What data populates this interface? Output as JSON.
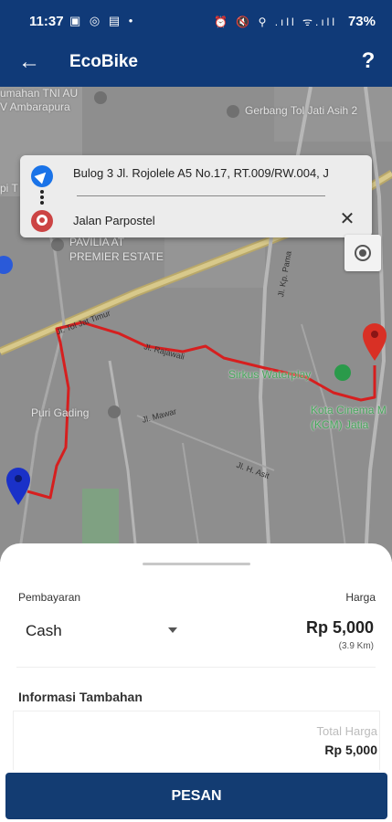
{
  "status_bar": {
    "time": "11:37",
    "left_icons": "▣ ◎ ▤ •",
    "right_icons": "⏰ 🔇 ⚲ .ıll ᯤ.ıll",
    "battery": "73%"
  },
  "app_bar": {
    "title": "EcoBike",
    "back_icon": "←",
    "help_icon": "?"
  },
  "map": {
    "labels": [
      "umahan TNI AU",
      "V Ambarapura",
      "Gerbang Tol Jati Asih 2",
      "PAVILIA AT",
      "PREMIER ESTATE",
      "Sirkus Waterplay",
      "Puri Gading",
      "Kota Cinema M",
      "(KCM) Jatia",
      "pi T",
      "Jl. Mawar",
      "Jl. H. Asit",
      "Jl. Rajawali",
      "Jl. Tol Jat Timur",
      "Jl. Kp. Pama"
    ]
  },
  "route": {
    "origin": "Bulog 3 Jl. Rojolele A5 No.17, RT.009/RW.004, J",
    "destination": "Jalan Parpostel",
    "clear_icon": "✕"
  },
  "sheet": {
    "payment_label": "Pembayaran",
    "price_label": "Harga",
    "payment_method": "Cash",
    "price": "Rp 5,000",
    "distance": "(3.9 Km)",
    "info_label": "Informasi Tambahan",
    "total_label": "Total Harga",
    "total_value": "Rp 5,000"
  },
  "order_button": "PESAN",
  "colors": {
    "primary": "#103a78",
    "route": "#d61f1f",
    "origin_marker": "#1a31c8",
    "dest_marker": "#d93025"
  }
}
